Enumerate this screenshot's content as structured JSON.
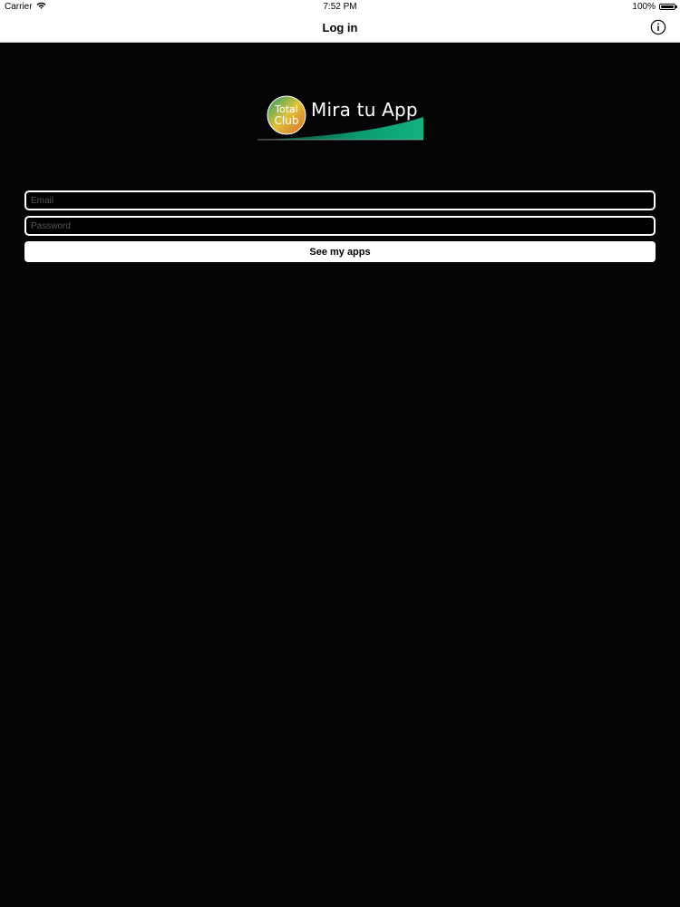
{
  "status_bar": {
    "carrier": "Carrier",
    "time": "7:52 PM",
    "battery": "100%",
    "battery_level": 1.0
  },
  "nav": {
    "title": "Log in",
    "info_icon": "info-icon"
  },
  "logo": {
    "badge_line1": "Total",
    "badge_line2": "Club",
    "text": "Mira tu App",
    "colors": {
      "badge_green": "#1f9a6a",
      "badge_yellow": "#e0c23a",
      "badge_orange": "#d86a2a",
      "swoosh": "#0b9a6e"
    }
  },
  "form": {
    "email_placeholder": "Email",
    "email_value": "",
    "password_placeholder": "Password",
    "password_value": "",
    "submit_label": "See my apps"
  }
}
